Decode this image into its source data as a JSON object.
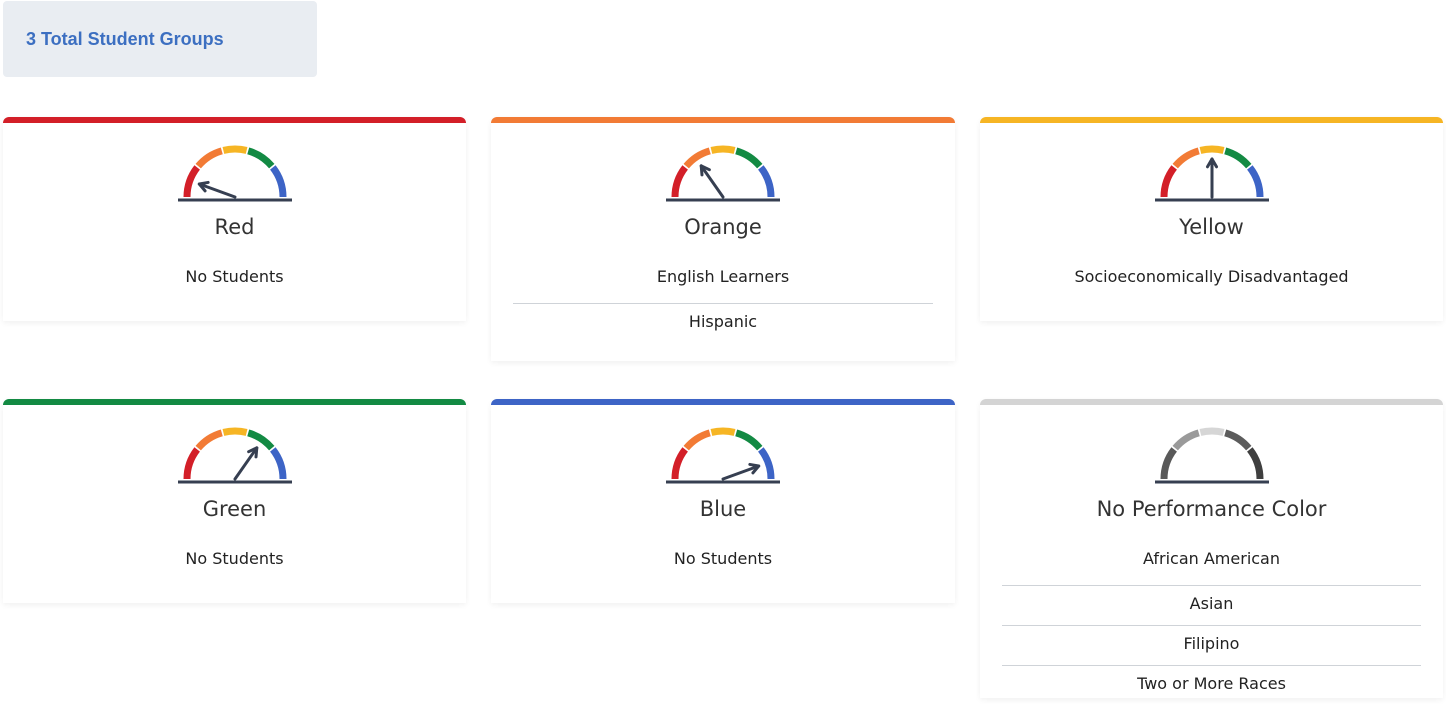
{
  "header": {
    "total_label": "3 Total Student Groups"
  },
  "colors": {
    "red": "#d31f28",
    "orange": "#f27b35",
    "yellow": "#f6b524",
    "green": "#138a43",
    "blue": "#3d64c6",
    "gray": "#d4d4d4",
    "needle": "#363f51"
  },
  "cards": [
    {
      "key": "red",
      "label": "Red",
      "icon": "gauge-red-icon",
      "groups": [
        "No Students"
      ]
    },
    {
      "key": "orange",
      "label": "Orange",
      "icon": "gauge-orange-icon",
      "groups": [
        "English Learners",
        "Hispanic"
      ]
    },
    {
      "key": "yellow",
      "label": "Yellow",
      "icon": "gauge-yellow-icon",
      "groups": [
        "Socioeconomically Disadvantaged"
      ]
    },
    {
      "key": "green",
      "label": "Green",
      "icon": "gauge-green-icon",
      "groups": [
        "No Students"
      ]
    },
    {
      "key": "blue",
      "label": "Blue",
      "icon": "gauge-blue-icon",
      "groups": [
        "No Students"
      ]
    },
    {
      "key": "none",
      "label": "No Performance Color",
      "icon": "gauge-none-icon",
      "groups": [
        "African American",
        "Asian",
        "Filipino",
        "Two or More Races"
      ]
    }
  ]
}
